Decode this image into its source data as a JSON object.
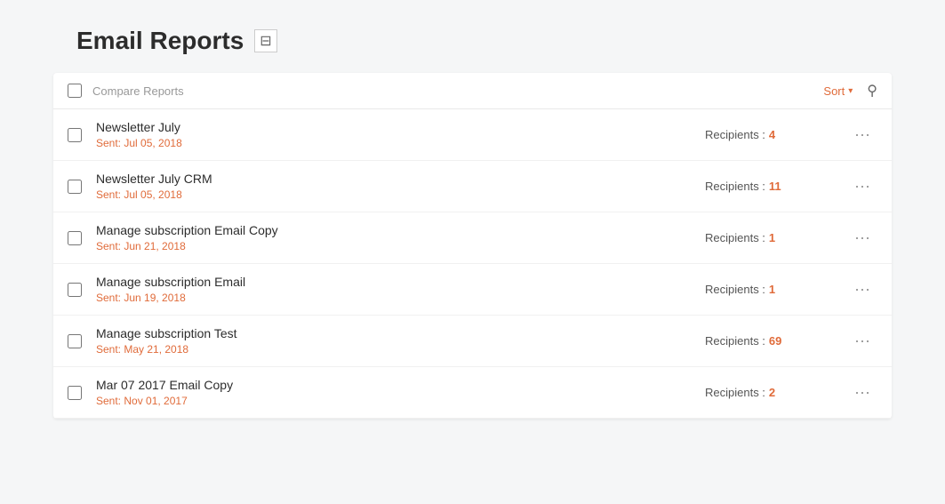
{
  "page": {
    "title": "Email Reports",
    "export_icon": "⊟"
  },
  "toolbar": {
    "compare_label": "Compare Reports",
    "sort_label": "Sort",
    "sort_chevron": "▾"
  },
  "reports": [
    {
      "id": 1,
      "name": "Newsletter July",
      "sent": "Sent: Jul 05, 2018",
      "recipients_label": "Recipients :",
      "recipients_count": "4"
    },
    {
      "id": 2,
      "name": "Newsletter July CRM",
      "sent": "Sent: Jul 05, 2018",
      "recipients_label": "Recipients :",
      "recipients_count": "11"
    },
    {
      "id": 3,
      "name": "Manage subscription Email Copy",
      "sent": "Sent: Jun 21, 2018",
      "recipients_label": "Recipients :",
      "recipients_count": "1"
    },
    {
      "id": 4,
      "name": "Manage subscription Email",
      "sent": "Sent: Jun 19, 2018",
      "recipients_label": "Recipients :",
      "recipients_count": "1"
    },
    {
      "id": 5,
      "name": "Manage subscription Test",
      "sent": "Sent: May 21, 2018",
      "recipients_label": "Recipients :",
      "recipients_count": "69"
    },
    {
      "id": 6,
      "name": "Mar 07 2017 Email Copy",
      "sent": "Sent: Nov 01, 2017",
      "recipients_label": "Recipients :",
      "recipients_count": "2"
    }
  ]
}
